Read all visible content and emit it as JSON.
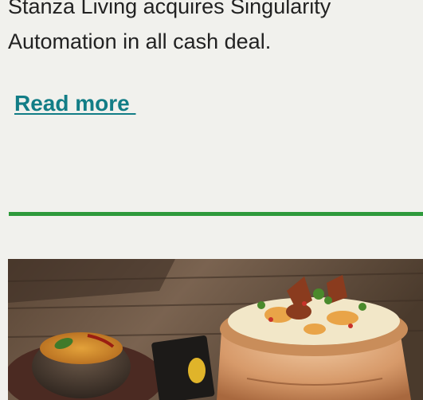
{
  "article": {
    "excerpt_line1": "Stanza Living acquires Singularity",
    "excerpt_line2": "Automation in all cash deal.",
    "read_more_label": "Read more "
  },
  "colors": {
    "background": "#f1f1ed",
    "link": "#127d86",
    "divider": "#2e9a3c",
    "body_text": "#222222"
  },
  "media": {
    "thumbnail_subject": "food-photo-biryani-pot"
  }
}
